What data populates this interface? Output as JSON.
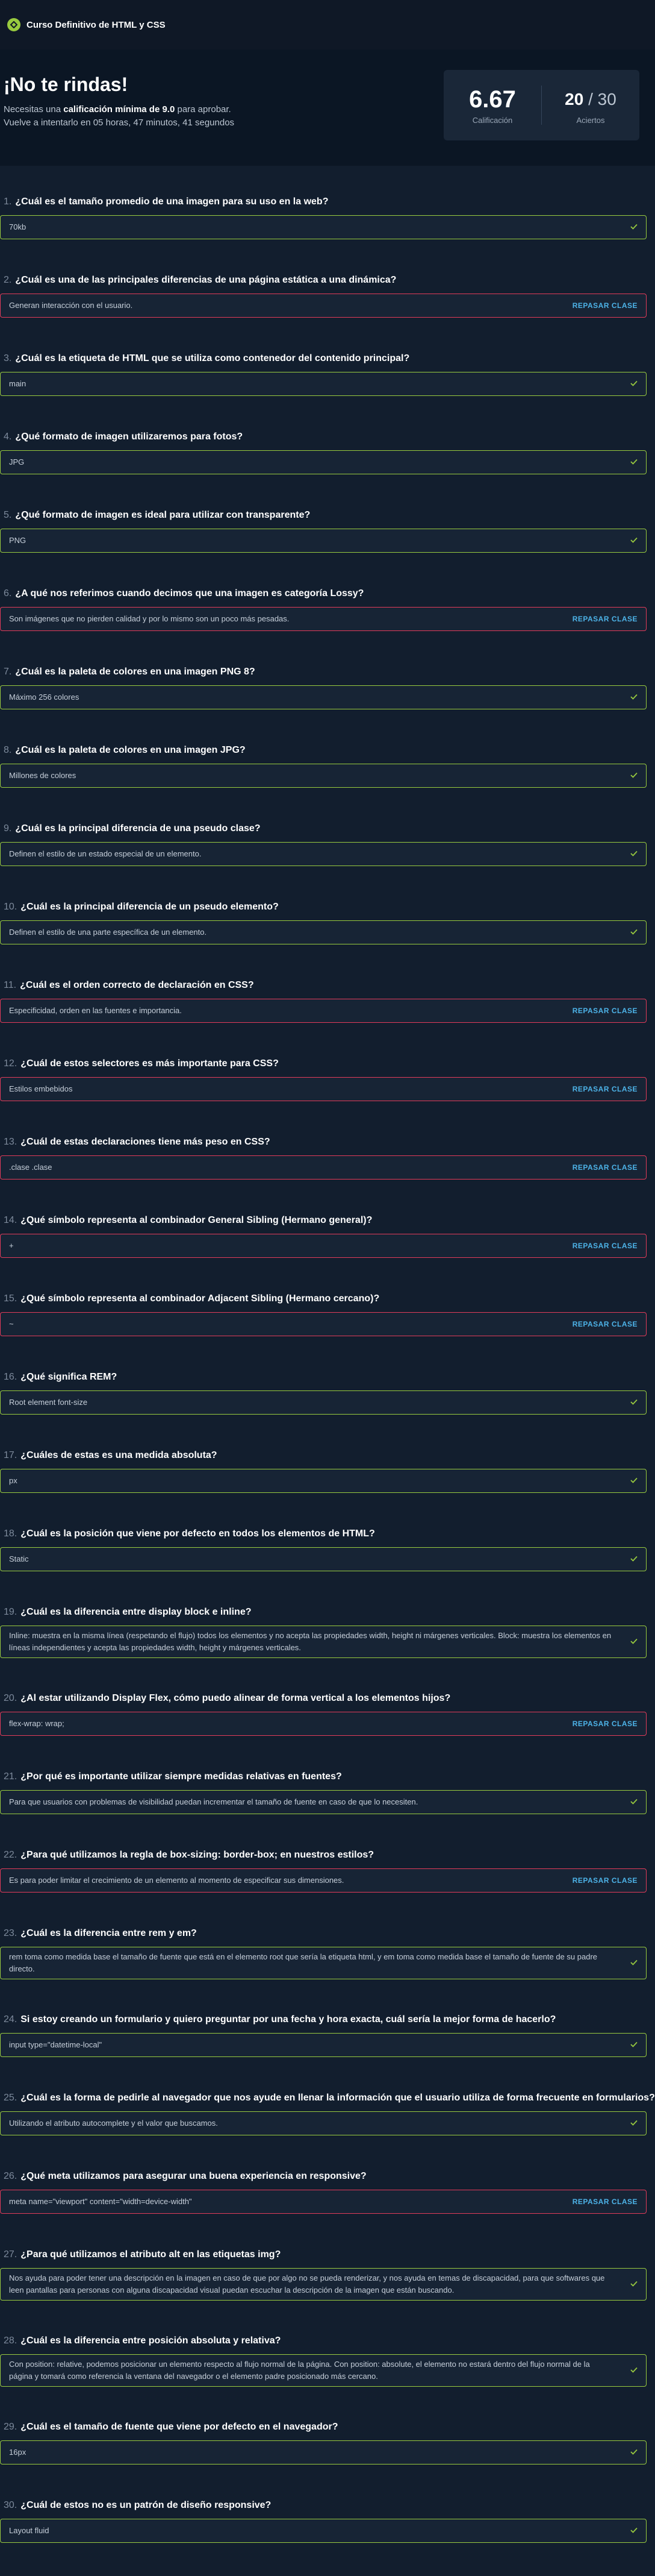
{
  "header": {
    "course_title": "Curso Definitivo de HTML y CSS"
  },
  "hero": {
    "title": "¡No te rindas!",
    "min_pre": "Necesitas una",
    "min_bold": "calificación mínima de 9.0",
    "min_post": "para aprobar.",
    "retry_pre": "Vuelve a intentarlo en",
    "retry_time": "05 horas, 47 minutos, 41 segundos"
  },
  "score": {
    "grade": "6.67",
    "grade_label": "Calificación",
    "correct": "20",
    "total": "/ 30",
    "correct_label": "Aciertos"
  },
  "review_label": "REPASAR CLASE",
  "colors": {
    "correct": "#98ca3f",
    "wrong": "#e23b5a",
    "link": "#4db3e8"
  },
  "questions": [
    {
      "num": "1.",
      "text": "¿Cuál es el tamaño promedio de una imagen para su uso en la web?",
      "answer": "70kb",
      "correct": true
    },
    {
      "num": "2.",
      "text": "¿Cuál es una de las principales diferencias de una página estática a una dinámica?",
      "answer": "Generan interacción con el usuario.",
      "correct": false
    },
    {
      "num": "3.",
      "text": "¿Cuál es la etiqueta de HTML que se utiliza como contenedor del contenido principal?",
      "answer": "main",
      "correct": true
    },
    {
      "num": "4.",
      "text": "¿Qué formato de imagen utilizaremos para fotos?",
      "answer": "JPG",
      "correct": true
    },
    {
      "num": "5.",
      "text": "¿Qué formato de imagen es ideal para utilizar con transparente?",
      "answer": "PNG",
      "correct": true
    },
    {
      "num": "6.",
      "text": "¿A qué nos referimos cuando decimos que una imagen es categoría Lossy?",
      "answer": "Son imágenes que no pierden calidad y por lo mismo son un poco más pesadas.",
      "correct": false
    },
    {
      "num": "7.",
      "text": "¿Cuál es la paleta de colores en una imagen PNG 8?",
      "answer": "Máximo 256 colores",
      "correct": true
    },
    {
      "num": "8.",
      "text": "¿Cuál es la paleta de colores en una imagen JPG?",
      "answer": "Millones de colores",
      "correct": true
    },
    {
      "num": "9.",
      "text": "¿Cuál es la principal diferencia de una pseudo clase?",
      "answer": "Definen el estilo de un estado especial de un elemento.",
      "correct": true
    },
    {
      "num": "10.",
      "text": "¿Cuál es la principal diferencia de un pseudo elemento?",
      "answer": "Definen el estilo de una parte específica de un elemento.",
      "correct": true
    },
    {
      "num": "11.",
      "text": "¿Cuál es el orden correcto de declaración en CSS?",
      "answer": "Especificidad, orden en las fuentes e importancia.",
      "correct": false
    },
    {
      "num": "12.",
      "text": "¿Cuál de estos selectores es más importante para CSS?",
      "answer": "Estilos embebidos",
      "correct": false
    },
    {
      "num": "13.",
      "text": "¿Cuál de estas declaraciones tiene más peso en CSS?",
      "answer": ".clase .clase",
      "correct": false
    },
    {
      "num": "14.",
      "text": "¿Qué símbolo representa al combinador General Sibling (Hermano general)?",
      "answer": "+",
      "correct": false
    },
    {
      "num": "15.",
      "text": "¿Qué símbolo representa al combinador Adjacent Sibling (Hermano cercano)?",
      "answer": "~",
      "correct": false
    },
    {
      "num": "16.",
      "text": "¿Qué significa REM?",
      "answer": "Root element font-size",
      "correct": true
    },
    {
      "num": "17.",
      "text": "¿Cuáles de estas es una medida absoluta?",
      "answer": "px",
      "correct": true
    },
    {
      "num": "18.",
      "text": "¿Cuál es la posición que viene por defecto en todos los elementos de HTML?",
      "answer": "Static",
      "correct": true
    },
    {
      "num": "19.",
      "text": "¿Cuál es la diferencia entre display block e inline?",
      "answer": "Inline: muestra en la misma línea (respetando el flujo) todos los elementos y no acepta las propiedades width, height ni márgenes verticales. Block: muestra los elementos en líneas independientes y acepta las propiedades width, height y márgenes verticales.",
      "correct": true,
      "tall": true
    },
    {
      "num": "20.",
      "text": "¿Al estar utilizando Display Flex, cómo puedo alinear de forma vertical a los elementos hijos?",
      "answer": "flex-wrap: wrap;",
      "correct": false
    },
    {
      "num": "21.",
      "text": "¿Por qué es importante utilizar siempre medidas relativas en fuentes?",
      "answer": "Para que usuarios con problemas de visibilidad puedan incrementar el tamaño de fuente en caso de que lo necesiten.",
      "correct": true
    },
    {
      "num": "22.",
      "text": "¿Para qué utilizamos la regla de box-sizing: border-box; en nuestros estilos?",
      "answer": "Es para poder limitar el crecimiento de un elemento al momento de especificar sus dimensiones.",
      "correct": false
    },
    {
      "num": "23.",
      "text": "¿Cuál es la diferencia entre rem y em?",
      "answer": "rem toma como medida base el tamaño de fuente que está en el elemento root que sería la etiqueta html, y em toma como medida base el tamaño de fuente de su padre directo.",
      "correct": true,
      "tall": true
    },
    {
      "num": "24.",
      "text": "Si estoy creando un formulario y quiero preguntar por una fecha y hora exacta, cuál sería la mejor forma de hacerlo?",
      "answer": "input type=\"datetime-local\"",
      "correct": true
    },
    {
      "num": "25.",
      "text": "¿Cuál es la forma de pedirle al navegador que nos ayude en llenar la información que el usuario utiliza de forma frecuente en formularios?",
      "answer": "Utilizando el atributo autocomplete y el valor que buscamos.",
      "correct": true
    },
    {
      "num": "26.",
      "text": "¿Qué meta utilizamos para asegurar una buena experiencia en responsive?",
      "answer": "meta name=\"viewport\" content=\"width=device-width\"",
      "correct": false
    },
    {
      "num": "27.",
      "text": "¿Para qué utilizamos el atributo alt en las etiquetas img?",
      "answer": "Nos ayuda para poder tener una descripción en la imagen en caso de que por algo no se pueda renderizar, y nos ayuda en temas de discapacidad, para que softwares que leen pantallas para personas con alguna discapacidad visual puedan escuchar la descripción de la imagen que están buscando.",
      "correct": true,
      "tall": true
    },
    {
      "num": "28.",
      "text": "¿Cuál es la diferencia entre posición absoluta y relativa?",
      "answer": "Con position: relative, podemos posicionar un elemento respecto al flujo normal de la página. Con position: absolute, el elemento no estará dentro del flujo normal de la página y tomará como referencia la ventana del navegador o el elemento padre posicionado más cercano.",
      "correct": true,
      "tall": true
    },
    {
      "num": "29.",
      "text": "¿Cuál es el tamaño de fuente que viene por defecto en el navegador?",
      "answer": "16px",
      "correct": true
    },
    {
      "num": "30.",
      "text": "¿Cuál de estos no es un patrón de diseño responsive?",
      "answer": "Layout fluid",
      "correct": true
    }
  ]
}
